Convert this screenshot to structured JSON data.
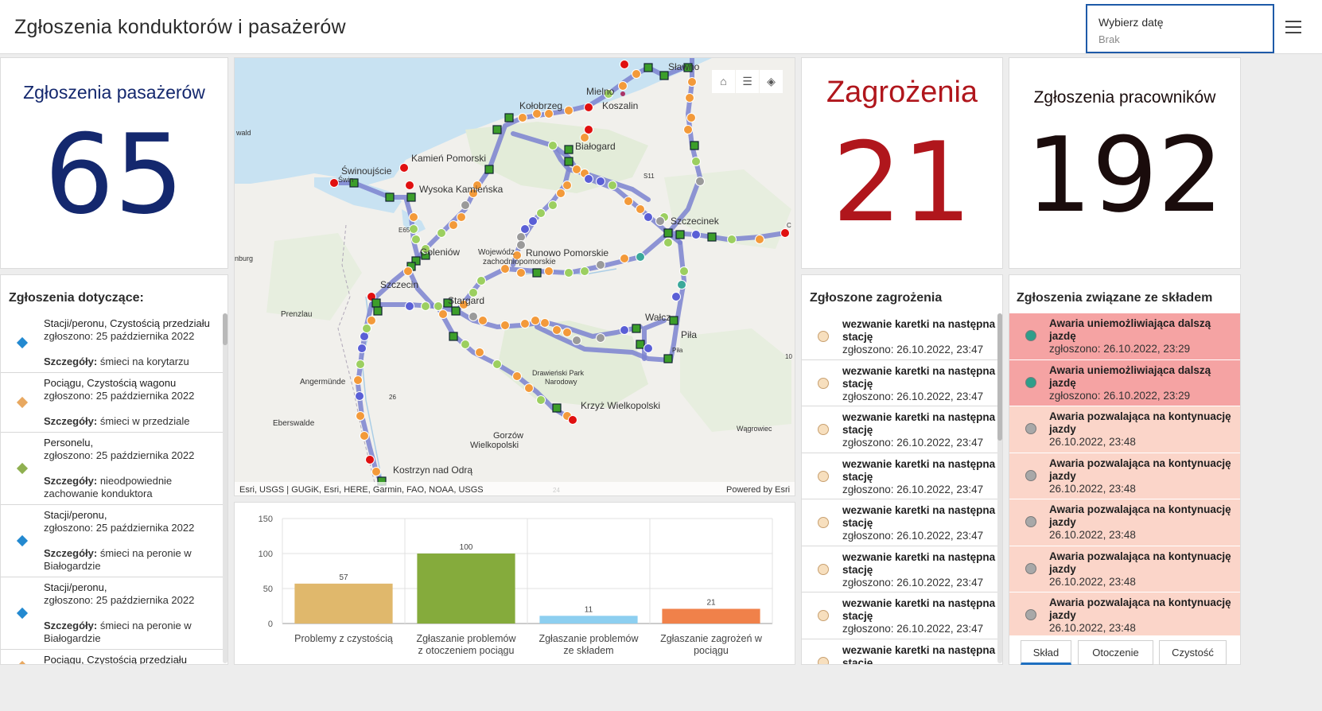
{
  "header": {
    "title": "Zgłoszenia konduktorów i pasażerów",
    "date_label": "Wybierz datę",
    "date_value": "Brak"
  },
  "indicators": {
    "passengers": {
      "title": "Zgłoszenia pasażerów",
      "value": "65",
      "color": "#14286e"
    },
    "threats": {
      "title": "Zagrożenia",
      "value": "21",
      "color": "#b0161c"
    },
    "workers": {
      "title": "Zgłoszenia pracowników",
      "value": "192",
      "color": "#1a0c0c"
    }
  },
  "passenger_list": {
    "title": "Zgłoszenia dotyczące:",
    "items": [
      {
        "type": "Stacji/peronu, Czystością przedziału",
        "reported": "zgłoszono: 25 października 2022",
        "details_label": "Szczegóły:",
        "details": "śmieci na korytarzu",
        "symbol": "blue"
      },
      {
        "type": "Pociągu, Czystością wagonu",
        "reported": "zgłoszono: 25 października 2022",
        "details_label": "Szczegóły:",
        "details": "śmieci w przedziale",
        "symbol": "orange"
      },
      {
        "type": "Personelu,",
        "reported": "zgłoszono: 25 października 2022",
        "details_label": "Szczegóły:",
        "details": "nieodpowiednie zachowanie konduktora",
        "symbol": "green"
      },
      {
        "type": "Stacji/peronu,",
        "reported": "zgłoszono: 25 października 2022",
        "details_label": "Szczegóły:",
        "details": "śmieci na peronie w Białogardzie",
        "symbol": "blue"
      },
      {
        "type": "Stacji/peronu,",
        "reported": "zgłoszono: 25 października 2022",
        "details_label": "Szczegóły:",
        "details": "śmieci na peronie w Białogardzie",
        "symbol": "blue"
      },
      {
        "type": "Pociągu, Czystością przedziału",
        "reported": "",
        "details_label": "",
        "details": "",
        "symbol": "orange"
      }
    ]
  },
  "threat_list": {
    "title": "Zgłoszone zagrożenia",
    "items": [
      {
        "text": "wezwanie karetki na następna stację",
        "reported": "zgłoszono: 26.10.2022, 23:47"
      },
      {
        "text": "wezwanie karetki na następna stację",
        "reported": "zgłoszono: 26.10.2022, 23:47"
      },
      {
        "text": "wezwanie karetki na następna stację",
        "reported": "zgłoszono: 26.10.2022, 23:47"
      },
      {
        "text": "wezwanie karetki na następna stację",
        "reported": "zgłoszono: 26.10.2022, 23:47"
      },
      {
        "text": "wezwanie karetki na następna stację",
        "reported": "zgłoszono: 26.10.2022, 23:47"
      },
      {
        "text": "wezwanie karetki na następna stację",
        "reported": "zgłoszono: 26.10.2022, 23:47"
      },
      {
        "text": "wezwanie karetki na następna stację",
        "reported": "zgłoszono: 26.10.2022, 23:47"
      },
      {
        "text": "wezwanie karetki na następna stację",
        "reported": ""
      }
    ]
  },
  "fleet_list": {
    "title": "Zgłoszenia związane ze składem",
    "items": [
      {
        "text": "Awaria uniemożliwiająca dalszą jazdę",
        "reported": "zgłoszono: 26.10.2022, 23:29",
        "bg": "#f5a3a3",
        "dot": "#2f9e8a"
      },
      {
        "text": "Awaria uniemożliwiająca dalszą jazdę",
        "reported": "zgłoszono: 26.10.2022, 23:29",
        "bg": "#f5a3a3",
        "dot": "#2f9e8a"
      },
      {
        "text": "Awaria pozwalająca na kontynuację jazdy",
        "reported": "26.10.2022, 23:48",
        "bg": "#fbd5c9",
        "dot": "#a8a8a8"
      },
      {
        "text": "Awaria pozwalająca na kontynuację jazdy",
        "reported": "26.10.2022, 23:48",
        "bg": "#fbd5c9",
        "dot": "#a8a8a8"
      },
      {
        "text": "Awaria pozwalająca na kontynuację jazdy",
        "reported": "26.10.2022, 23:48",
        "bg": "#fbd5c9",
        "dot": "#a8a8a8"
      },
      {
        "text": "Awaria pozwalająca na kontynuację jazdy",
        "reported": "26.10.2022, 23:48",
        "bg": "#fbd5c9",
        "dot": "#a8a8a8"
      },
      {
        "text": "Awaria pozwalająca na kontynuację jazdy",
        "reported": "26.10.2022, 23:48",
        "bg": "#fbd5c9",
        "dot": "#a8a8a8"
      }
    ]
  },
  "fleet_tabs": [
    {
      "label": "Skład",
      "active": true
    },
    {
      "label": "Otoczenie",
      "active": false
    },
    {
      "label": "Czystość",
      "active": false
    }
  ],
  "map": {
    "attribution": "Esri, USGS | GUGiK, Esri, HERE, Garmin, FAO, NOAA, USGS",
    "powered_by": "Powered by Esri",
    "tools": [
      {
        "name": "home-icon",
        "glyph": "⌂"
      },
      {
        "name": "legend-icon",
        "glyph": "☰"
      },
      {
        "name": "layers-icon",
        "glyph": "◈"
      }
    ],
    "labels": {
      "slawno": "Sławno",
      "mielno": "Mielno",
      "koszalin": "Koszalin",
      "kolobrzeg": "Kołobrzeg",
      "bialogard": "Białogard",
      "kamien": "Kamień Pomorski",
      "swinoujscie": "Świnoujście",
      "swin_small": "Świn",
      "wysoka": "Wysoka Kamieńska",
      "goleniow": "Goleniów",
      "runowo": "Runowo Pomorskie",
      "wojew": "Wojewódz",
      "zachodniopom": "zachodniopomorskie",
      "szczecin": "Szczecin",
      "stargard": "Stargard",
      "walcz": "Wałcz",
      "pila": "Piła",
      "pila_small": "Piła",
      "szczecinek": "Szczecinek",
      "krzyz": "Krzyż Wielkopolski",
      "gorzow1": "Gorzów",
      "gorzow2": "Wielkopolski",
      "kostrzyn": "Kostrzyn nad Odrą",
      "drawienski1": "Drawieński Park",
      "drawienski2": "Narodowy",
      "prenzlau": "Prenzlau",
      "angermunde": "Angermünde",
      "eberswalde": "Eberswalde",
      "wagrowiec": "Wągrowiec",
      "wald": "wald",
      "nburg": "nburg",
      "e65": "E65",
      "s11": "S11",
      "r26": "26",
      "r10": "10",
      "r24": "24",
      "c": "C"
    }
  },
  "chart_data": {
    "type": "bar",
    "categories": [
      "Problemy z czystością",
      "Zgłaszanie problemów z otoczeniem pociągu",
      "Zgłaszanie problemów ze składem",
      "Zgłaszanie zagrożeń w pociągu"
    ],
    "category_lines": [
      [
        "Problemy z czystością"
      ],
      [
        "Zgłaszanie problemów",
        "z otoczeniem pociągu"
      ],
      [
        "Zgłaszanie problemów",
        "ze składem"
      ],
      [
        "Zgłaszanie zagrożeń w",
        "pociągu"
      ]
    ],
    "values": [
      57,
      100,
      11,
      21
    ],
    "colors": [
      "#e0b86c",
      "#85ab3c",
      "#8dcff0",
      "#f0814a"
    ],
    "ylim": [
      0,
      150
    ],
    "yticks": [
      0,
      50,
      100,
      150
    ],
    "grid": true,
    "title": "",
    "xlabel": "",
    "ylabel": ""
  }
}
